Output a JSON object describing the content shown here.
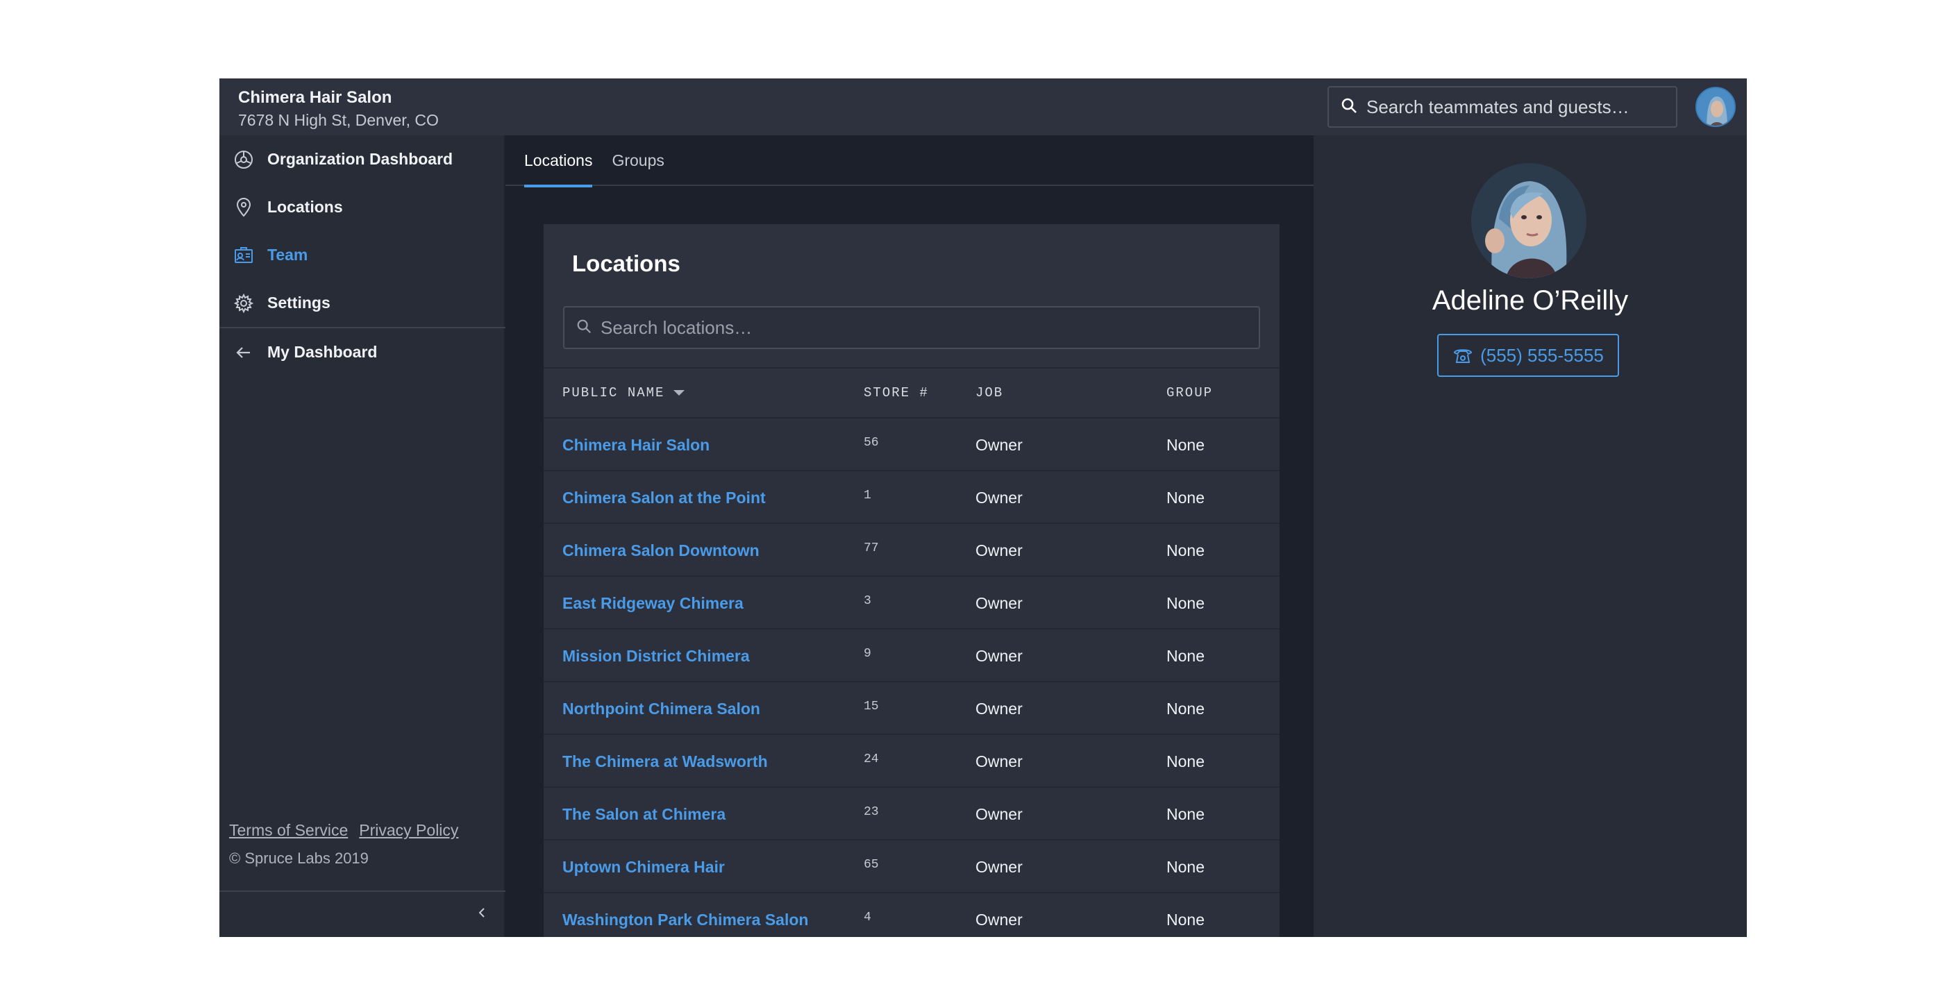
{
  "org": {
    "name": "Chimera Hair Salon",
    "address": "7678 N High St, Denver, CO"
  },
  "nav": {
    "items": [
      {
        "label": "Organization Dashboard",
        "icon": "dashboard-icon"
      },
      {
        "label": "Locations",
        "icon": "location-pin-icon"
      },
      {
        "label": "Team",
        "icon": "id-card-icon",
        "active": true
      },
      {
        "label": "Settings",
        "icon": "gear-icon"
      }
    ],
    "my_dashboard": {
      "label": "My Dashboard",
      "icon": "arrow-left-icon"
    }
  },
  "footer": {
    "terms": "Terms of Service",
    "privacy": "Privacy Policy",
    "copyright": "© Spruce Labs 2019"
  },
  "top_search": {
    "placeholder": "Search teammates and guests…"
  },
  "tabs": [
    {
      "label": "Locations",
      "active": true
    },
    {
      "label": "Groups"
    }
  ],
  "locations_card": {
    "title": "Locations",
    "search_placeholder": "Search locations…",
    "columns": {
      "public_name": "PUBLIC NAME",
      "store": "STORE #",
      "job": "JOB",
      "group": "GROUP"
    },
    "rows": [
      {
        "name": "Chimera Hair Salon",
        "store": "56",
        "job": "Owner",
        "group": "None"
      },
      {
        "name": "Chimera Salon at the Point",
        "store": "1",
        "job": "Owner",
        "group": "None"
      },
      {
        "name": "Chimera Salon Downtown",
        "store": "77",
        "job": "Owner",
        "group": "None"
      },
      {
        "name": "East Ridgeway Chimera",
        "store": "3",
        "job": "Owner",
        "group": "None"
      },
      {
        "name": "Mission District Chimera",
        "store": "9",
        "job": "Owner",
        "group": "None"
      },
      {
        "name": "Northpoint Chimera Salon",
        "store": "15",
        "job": "Owner",
        "group": "None"
      },
      {
        "name": "The Chimera at Wadsworth",
        "store": "24",
        "job": "Owner",
        "group": "None"
      },
      {
        "name": "The Salon at Chimera",
        "store": "23",
        "job": "Owner",
        "group": "None"
      },
      {
        "name": "Uptown Chimera Hair",
        "store": "65",
        "job": "Owner",
        "group": "None"
      },
      {
        "name": "Washington Park Chimera Salon",
        "store": "4",
        "job": "Owner",
        "group": "None"
      }
    ]
  },
  "profile": {
    "name": "Adeline O’Reilly",
    "phone": "(555) 555-5555"
  },
  "colors": {
    "accent": "#4a9be8",
    "sidebar": "#272c37",
    "card": "#2d323e",
    "background": "#1b202a"
  }
}
